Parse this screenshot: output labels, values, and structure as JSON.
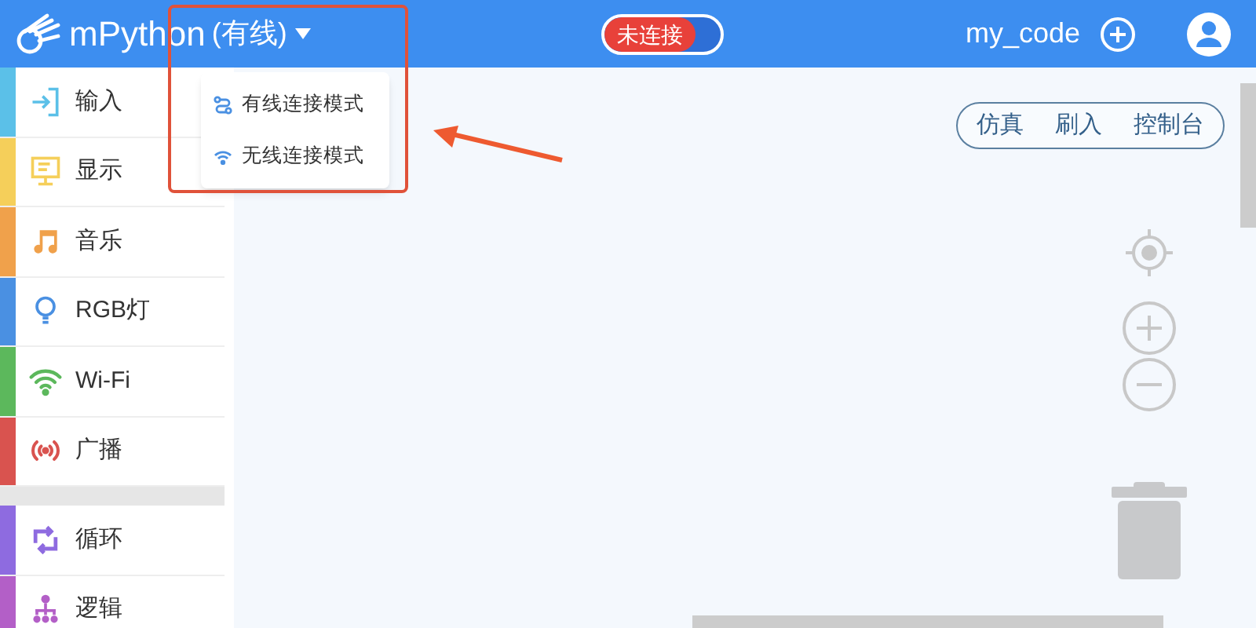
{
  "header": {
    "brand": "mPython",
    "mode": "(有线)",
    "connection": {
      "label": "未连接",
      "connected": false
    },
    "file_name": "my_code"
  },
  "mode_menu": {
    "expanded": true,
    "items": [
      {
        "label": "有线连接模式",
        "kind": "wired"
      },
      {
        "label": "无线连接模式",
        "kind": "wireless"
      }
    ]
  },
  "sidebar": {
    "groups": [
      {
        "items": [
          {
            "label": "输入",
            "color": "#5bc0e8"
          },
          {
            "label": "显示",
            "color": "#f5cf5a"
          },
          {
            "label": "音乐",
            "color": "#f0a14b"
          },
          {
            "label": "RGB灯",
            "color": "#4a90e2"
          },
          {
            "label": "Wi-Fi",
            "color": "#5cb85c"
          },
          {
            "label": "广播",
            "color": "#d9534f"
          }
        ]
      },
      {
        "items": [
          {
            "label": "循环",
            "color": "#8e6be0"
          },
          {
            "label": "逻辑",
            "color": "#b35fc7"
          }
        ]
      }
    ]
  },
  "toolbar": {
    "buttons": [
      "仿真",
      "刷入",
      "控制台"
    ]
  }
}
